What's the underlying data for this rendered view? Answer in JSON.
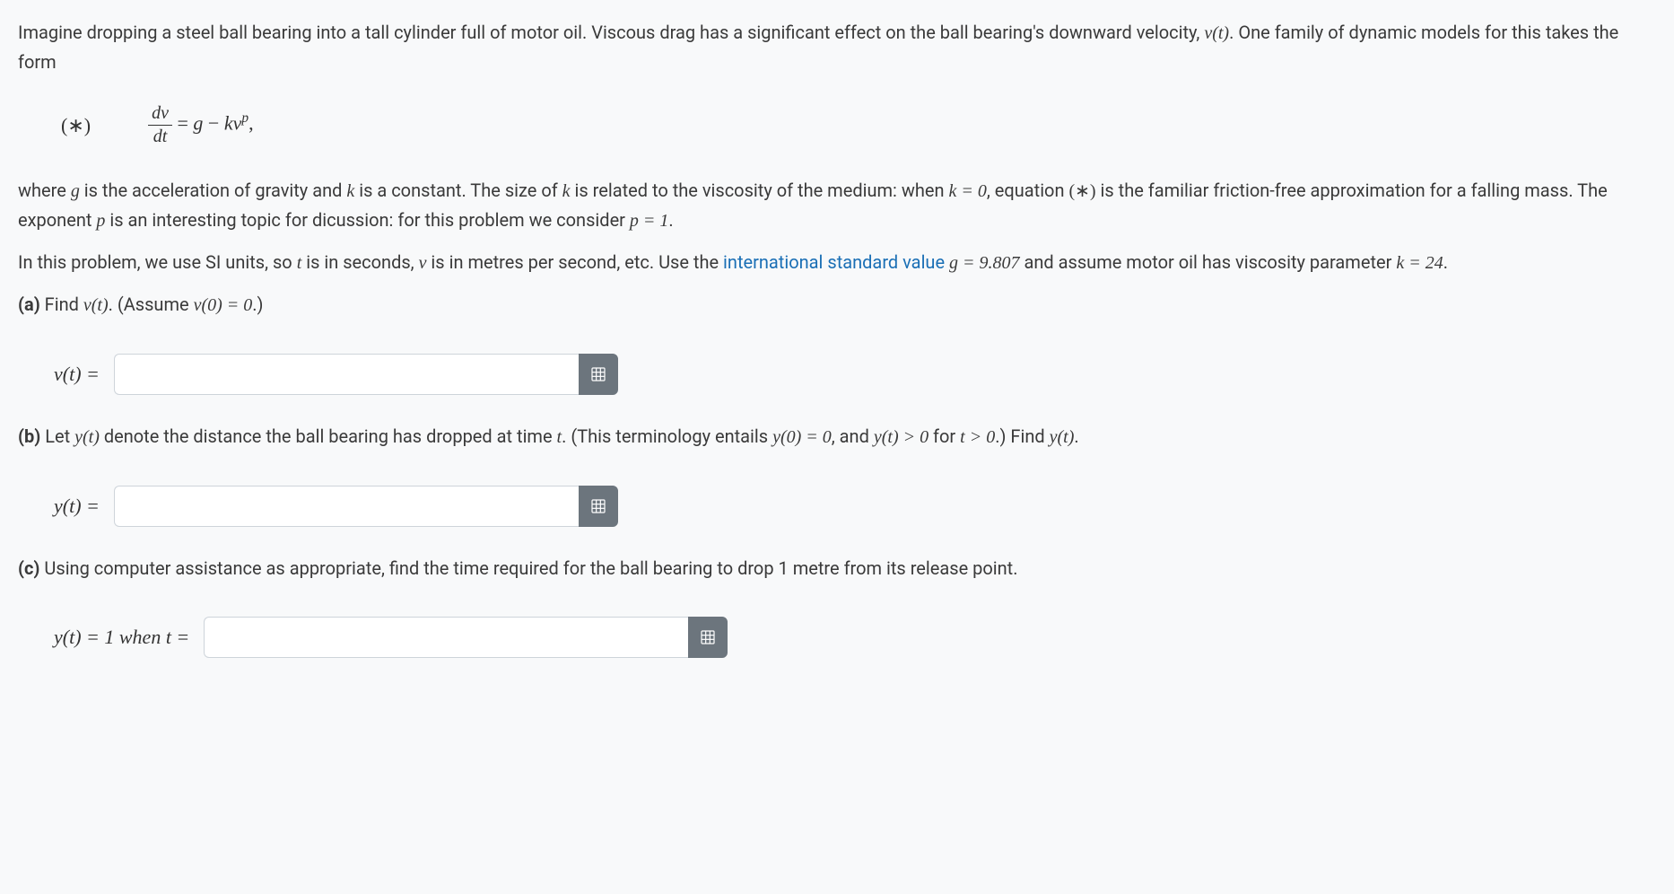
{
  "problem": {
    "intro": "Imagine dropping a steel ball bearing into a tall cylinder full of motor oil. Viscous drag has a significant effect on the ball bearing's downward velocity, ",
    "intro_var": "v(t)",
    "intro_end": ". One family of dynamic models for this takes the form",
    "eq_label": "(∗)",
    "eq_frac_num": "dv",
    "eq_frac_den": "dt",
    "eq_rhs_equals": " = ",
    "eq_rhs_g": "g",
    "eq_rhs_minus": " − ",
    "eq_rhs_k": "k",
    "eq_rhs_v": "v",
    "eq_rhs_p": "p",
    "eq_rhs_comma": ",",
    "para2_a": "where ",
    "para2_g": "g",
    "para2_b": " is the acceleration of gravity and ",
    "para2_k": "k",
    "para2_c": " is a constant. The size of ",
    "para2_k2": "k",
    "para2_d": " is related to the viscosity of the medium: when ",
    "para2_eq1": "k = 0",
    "para2_e": ", equation ",
    "para2_star": "(∗)",
    "para2_f": " is the familiar friction-free approximation for a falling mass. The exponent ",
    "para2_p": "p",
    "para2_g2": " is an interesting topic for dicussion: for this problem we consider ",
    "para2_eq2": "p = 1",
    "para2_h": ".",
    "para3_a": "In this problem, we use SI units, so ",
    "para3_t": "t",
    "para3_b": " is in seconds, ",
    "para3_v": "v",
    "para3_c": " is in metres per second, etc. Use the ",
    "para3_link": "international standard value",
    "para3_d": " ",
    "para3_eq1": "g = 9.807",
    "para3_e": " and assume motor oil has viscosity parameter ",
    "para3_eq2": "k = 24",
    "para3_f": ".",
    "a_label": "(a)",
    "a_text1": " Find ",
    "a_vt": "v(t)",
    "a_text2": ". (Assume ",
    "a_cond": "v(0) = 0",
    "a_text3": ".)",
    "a_lhs": "v(t) = ",
    "b_label": "(b)",
    "b_text1": " Let ",
    "b_yt": "y(t)",
    "b_text2": " denote the distance the ball bearing has dropped at time ",
    "b_t": "t",
    "b_text3": ". (This terminology entails ",
    "b_cond1": "y(0) = 0",
    "b_text4": ", and ",
    "b_cond2": "y(t) > 0",
    "b_text5": " for ",
    "b_cond3": "t > 0",
    "b_text6": ".) Find ",
    "b_yt2": "y(t)",
    "b_text7": ".",
    "b_lhs": "y(t) = ",
    "c_label": "(c)",
    "c_text": " Using computer assistance as appropriate, find the time required for the ball bearing to drop 1 metre from its release point.",
    "c_lhs": "y(t) = 1 when t = "
  },
  "inputs": {
    "a_value": "",
    "b_value": "",
    "c_value": ""
  }
}
